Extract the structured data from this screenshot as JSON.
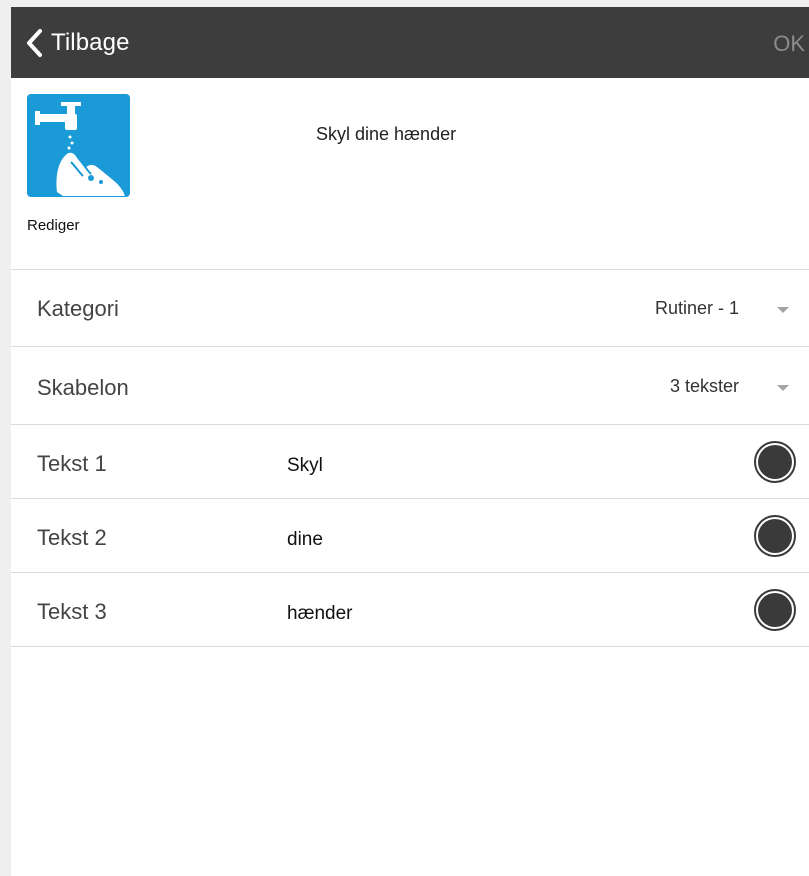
{
  "navbar": {
    "back_label": "Tilbage",
    "ok_label": "OK",
    "background": "#3d3d3d"
  },
  "activity": {
    "title": "Skyl dine hænder",
    "edit_label": "Rediger",
    "pictogram_icon": "wash-hands-icon",
    "pictogram_color": "#1a9ad6"
  },
  "settings": {
    "category": {
      "label": "Kategori",
      "value": "Rutiner - 1"
    },
    "template": {
      "label": "Skabelon",
      "value": "3 tekster"
    }
  },
  "texts": [
    {
      "label": "Tekst 1",
      "value": "Skyl",
      "color": "#3a3a3a"
    },
    {
      "label": "Tekst 2",
      "value": "dine",
      "color": "#3a3a3a"
    },
    {
      "label": "Tekst 3",
      "value": "hænder",
      "color": "#3a3a3a"
    }
  ]
}
